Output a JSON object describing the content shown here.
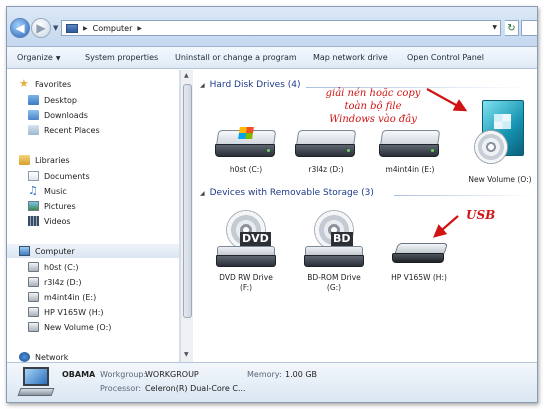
{
  "address": {
    "path": [
      "Computer"
    ]
  },
  "commands": {
    "organize": "Organize",
    "system_properties": "System properties",
    "uninstall": "Uninstall or change a program",
    "map_network_drive": "Map network drive",
    "open_control_panel": "Open Control Panel"
  },
  "nav": {
    "favorites": "Favorites",
    "desktop": "Desktop",
    "downloads": "Downloads",
    "recent_places": "Recent Places",
    "libraries": "Libraries",
    "documents": "Documents",
    "music": "Music",
    "pictures": "Pictures",
    "videos": "Videos",
    "computer": "Computer",
    "drive_c": "h0st (C:)",
    "drive_d": "r3l4z (D:)",
    "drive_e": "m4int4in (E:)",
    "drive_h": "HP V165W (H:)",
    "drive_o": "New Volume (O:)",
    "network": "Network"
  },
  "content": {
    "hdd_group": "Hard Disk Drives (4)",
    "hdd_items": [
      "h0st (C:)",
      "r3l4z (D:)",
      "m4int4in (E:)",
      "New Volume (O:)"
    ],
    "removable_group": "Devices with Removable Storage (3)",
    "removable_items": [
      {
        "line1": "DVD RW Drive",
        "line2": "(F:)",
        "tag": "DVD"
      },
      {
        "line1": "BD-ROM Drive",
        "line2": "(G:)",
        "tag": "BD"
      },
      {
        "line1": "HP V165W (H:)",
        "line2": ""
      }
    ]
  },
  "annotations": {
    "copy_note_1": "giải nén hoặc copy",
    "copy_note_2": "toàn bộ file",
    "copy_note_3": "Windows vào đây",
    "usb_note": "USB",
    "color": "#d01414"
  },
  "details": {
    "computer_name": "OBAMA",
    "workgroup_label": "Workgroup:",
    "workgroup_value": "WORKGROUP",
    "memory_label": "Memory:",
    "memory_value": "1.00 GB",
    "processor_label": "Processor:",
    "processor_value": "Celeron(R) Dual-Core C..."
  }
}
